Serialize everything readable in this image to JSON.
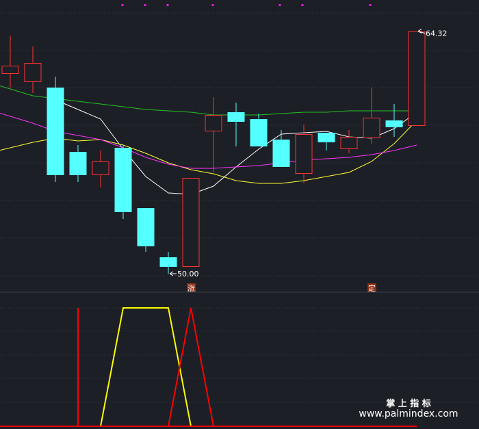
{
  "chart_data": [
    {
      "type": "candlestick",
      "title": "",
      "ylim": [
        46,
        66
      ],
      "candles": [
        {
          "open": 61.2,
          "close": 61.8,
          "high": 64.0,
          "low": 60.2
        },
        {
          "open": 60.6,
          "close": 62.0,
          "high": 63.2,
          "low": 59.8
        },
        {
          "open": 60.2,
          "close": 53.8,
          "high": 61.0,
          "low": 53.3
        },
        {
          "open": 55.5,
          "close": 53.8,
          "high": 56.0,
          "low": 53.3
        },
        {
          "open": 53.8,
          "close": 54.8,
          "high": 55.6,
          "low": 52.9
        },
        {
          "open": 55.8,
          "close": 51.1,
          "high": 56.0,
          "low": 50.6
        },
        {
          "open": 51.4,
          "close": 48.6,
          "high": 51.4,
          "low": 48.2
        },
        {
          "open": 47.8,
          "close": 47.1,
          "high": 48.2,
          "low": 46.6
        },
        {
          "open": 47.1,
          "close": 53.6,
          "high": 53.6,
          "low": 47.1
        },
        {
          "open": 57.0,
          "close": 58.2,
          "high": 59.5,
          "low": 54.0
        },
        {
          "open": 58.4,
          "close": 57.7,
          "high": 59.1,
          "low": 55.9
        },
        {
          "open": 57.9,
          "close": 55.9,
          "high": 58.3,
          "low": 55.9
        },
        {
          "open": 56.4,
          "close": 54.4,
          "high": 57.1,
          "low": 54.4
        },
        {
          "open": 53.9,
          "close": 56.8,
          "high": 57.5,
          "low": 53.2
        },
        {
          "open": 56.9,
          "close": 56.2,
          "high": 56.9,
          "low": 55.6
        },
        {
          "open": 55.7,
          "close": 56.6,
          "high": 57.1,
          "low": 55.4
        },
        {
          "open": 56.5,
          "close": 58.0,
          "high": 60.2,
          "low": 56.1
        },
        {
          "open": 57.8,
          "close": 57.3,
          "high": 59.0,
          "low": 56.6
        },
        {
          "open": 57.4,
          "close": 64.32,
          "high": 64.32,
          "low": 57.4
        }
      ],
      "ma_lines": [
        {
          "color": "#ffffff",
          "values": [
            null,
            null,
            59.3,
            58.6,
            57.9,
            55.7,
            53.7,
            52.5,
            52.4,
            53.0,
            54.4,
            55.7,
            56.8,
            56.9,
            57.0,
            56.6,
            56.5,
            57.2,
            58.4
          ]
        },
        {
          "color": "#ffff33",
          "values": [
            55.8,
            56.2,
            56.5,
            56.3,
            56.4,
            56.0,
            55.4,
            54.7,
            54.2,
            53.9,
            53.4,
            53.2,
            53.2,
            53.4,
            53.7,
            54.0,
            54.8,
            56.1,
            57.8
          ]
        },
        {
          "color": "#ff33ff",
          "values": [
            58.1,
            57.6,
            57.0,
            56.7,
            56.4,
            55.8,
            55.1,
            54.6,
            54.3,
            54.3,
            54.4,
            54.5,
            54.7,
            54.9,
            55.0,
            55.1,
            55.3,
            55.6,
            56.0
          ]
        },
        {
          "color": "#22c422",
          "values": [
            60.1,
            59.6,
            59.4,
            59.2,
            59.0,
            58.8,
            58.6,
            58.5,
            58.4,
            58.2,
            58.2,
            58.2,
            58.3,
            58.4,
            58.4,
            58.5,
            58.5,
            58.5,
            58.5
          ]
        }
      ],
      "annotations": [
        {
          "text": "50.00",
          "candle": 7
        },
        {
          "text": "64.32",
          "candle": 18
        }
      ],
      "markers": [
        {
          "text": "涨",
          "candle": 8
        },
        {
          "text": "定",
          "candle": 16
        }
      ]
    },
    {
      "type": "line",
      "ylim": [
        0,
        1
      ],
      "x": [
        0,
        1,
        2,
        3,
        4,
        5,
        6,
        7,
        8,
        9,
        10,
        11,
        12,
        13,
        14,
        15,
        16,
        17,
        18
      ],
      "series": [
        {
          "color": "#e0e0e0",
          "values": [
            0,
            0,
            0,
            0,
            0,
            0,
            0,
            0,
            0,
            0,
            0,
            0,
            0,
            0,
            0,
            0,
            0,
            0,
            0
          ]
        },
        {
          "color": "#ffff00",
          "values": [
            0,
            0,
            0,
            0,
            0,
            1,
            1,
            1,
            0,
            0,
            0,
            0,
            0,
            0,
            0,
            0,
            0,
            0,
            0
          ]
        },
        {
          "color": "#ff0000",
          "values": [
            0,
            0,
            0,
            0,
            0,
            0,
            0,
            0,
            1,
            0,
            0,
            0,
            0,
            0,
            0,
            0,
            0,
            0,
            0
          ]
        }
      ],
      "bars": [
        {
          "candle": 3,
          "value": 1,
          "color": "#ff0000"
        }
      ]
    }
  ],
  "watermark": {
    "line1": "掌 上 指 标",
    "line2": "www.palmindex.com"
  }
}
